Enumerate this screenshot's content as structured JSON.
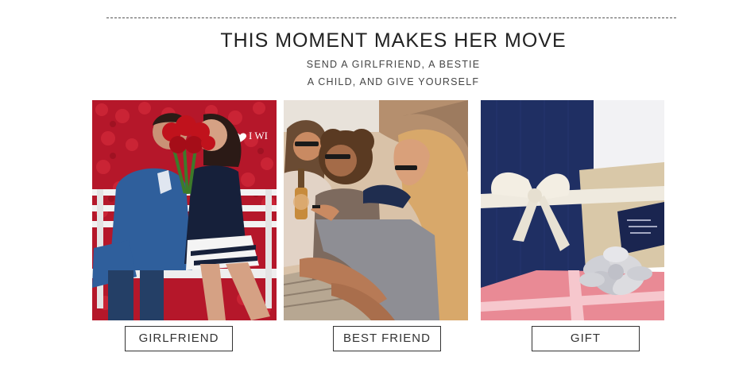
{
  "header": {
    "title": "THIS MOMENT MAKES HER MOVE",
    "subtitle_line1": "SEND A GIRLFRIEND, A BESTIE",
    "subtitle_line2": "A CHILD, AND GIVE YOURSELF"
  },
  "cards": [
    {
      "label": "GIRLFRIEND",
      "image_text": "I WI",
      "colors": {
        "background": "#b5172a",
        "bench": "#f2f2f2",
        "suit": "#2f5f9c",
        "dress": "#16203a",
        "roses": "#c0121c"
      }
    },
    {
      "label": "BEST FRIEND",
      "colors": {
        "sand": "#d9c2a8",
        "sky": "#e8e2da",
        "hair": "#d8a86a",
        "sleeve": "#8e8e94",
        "skin": "#c98a62"
      }
    },
    {
      "label": "GIFT",
      "colors": {
        "box": "#1f2f63",
        "ribbon": "#efeadf",
        "bow": "#d8d8dc",
        "pink_box": "#e98a95",
        "tag": "#1a2550"
      }
    }
  ]
}
